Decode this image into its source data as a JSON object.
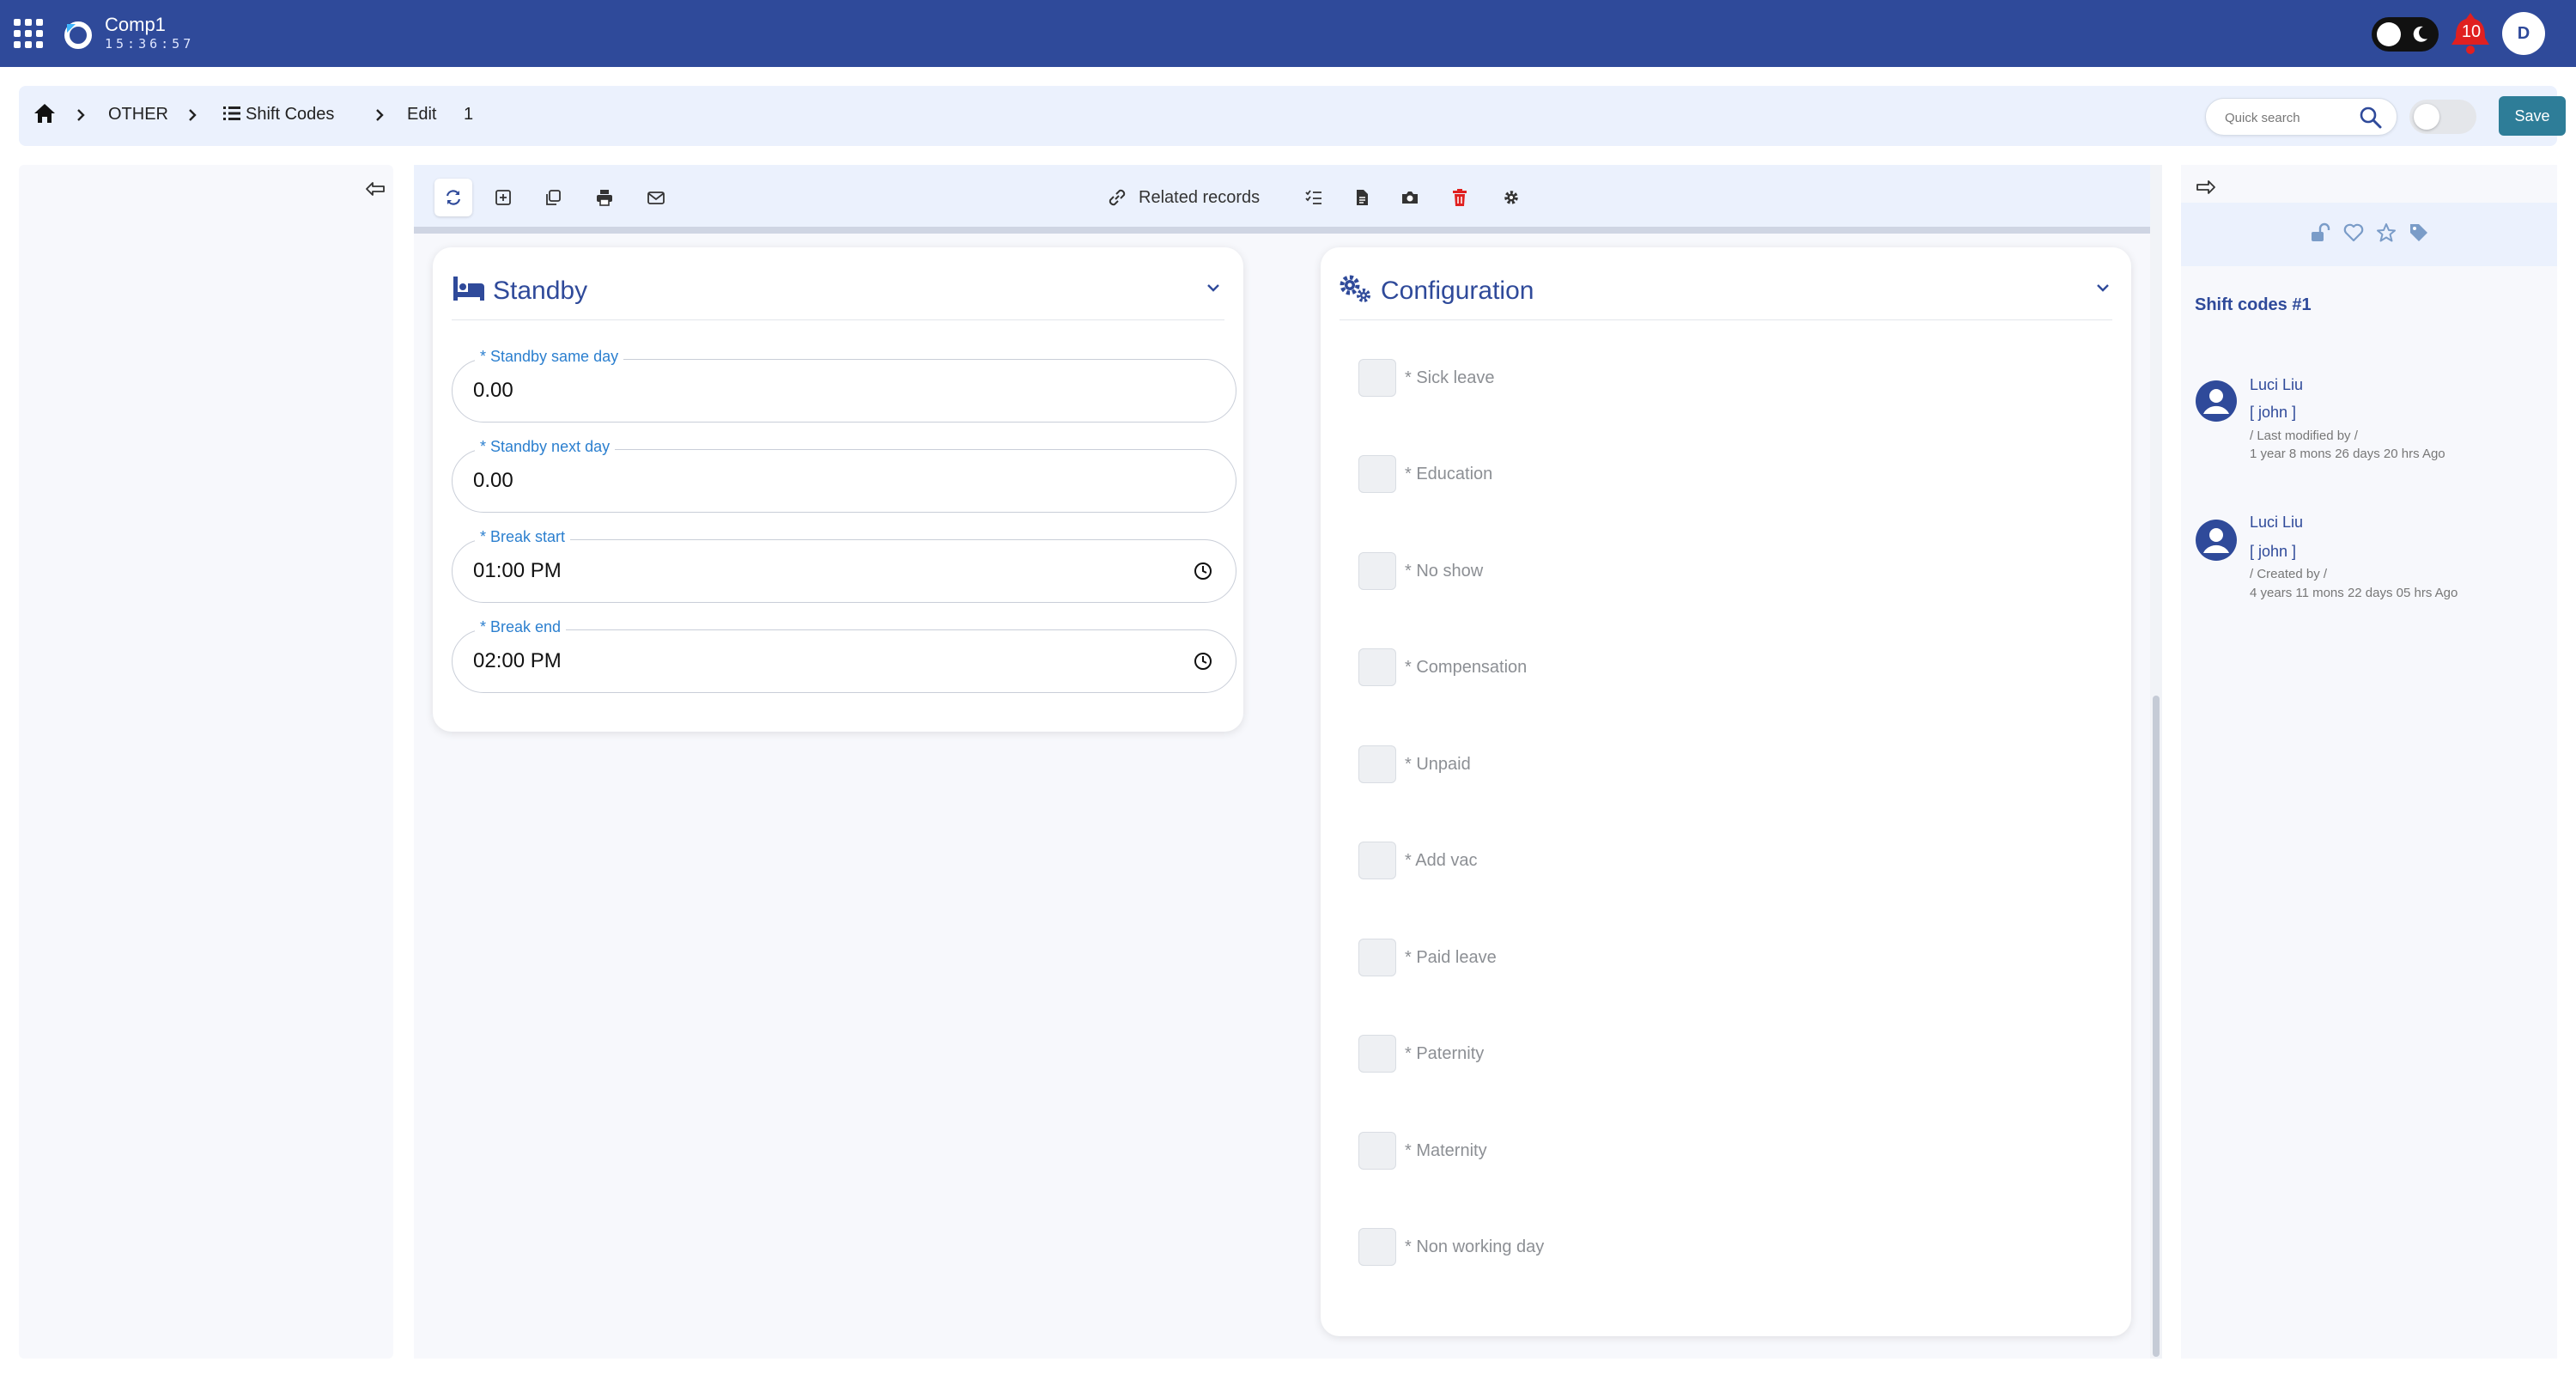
{
  "header": {
    "company": "Comp1",
    "clock": "15:36:57",
    "notifications": "10",
    "user_initial": "D"
  },
  "breadcrumb": {
    "level1": "OTHER",
    "level2": "Shift Codes",
    "level3": "Edit",
    "record_id": "1"
  },
  "search": {
    "placeholder": "Quick search"
  },
  "actions": {
    "save_label": "Save"
  },
  "toolbar": {
    "related_records": "Related records"
  },
  "standby": {
    "title": "Standby",
    "fields": [
      {
        "label": "* Standby same day",
        "value": "0.00"
      },
      {
        "label": "* Standby next day",
        "value": "0.00"
      },
      {
        "label": "* Break start",
        "value": "01:00 PM"
      },
      {
        "label": "* Break end",
        "value": "02:00 PM"
      }
    ]
  },
  "configuration": {
    "title": "Configuration",
    "items": [
      "* Sick leave",
      "* Education",
      "* No show",
      "* Compensation",
      "* Unpaid",
      "* Add vac",
      "* Paid leave",
      "* Paternity",
      "* Maternity",
      "* Non working day"
    ]
  },
  "record": {
    "title": "Shift codes #1",
    "audit": [
      {
        "name": "Luci Liu",
        "user": "[ john ]",
        "action": "/ Last modified by /",
        "when": "1 year 8 mons 26 days 20 hrs Ago"
      },
      {
        "name": "Luci Liu",
        "user": "[ john ]",
        "action": "/ Created by /",
        "when": "4 years 11 mons 22 days 05 hrs Ago"
      }
    ]
  },
  "colors": {
    "topbar": "#2f4a9a",
    "accent": "#2f4a9a",
    "save_button": "#2e7d98",
    "label_blue": "#2b7fcf",
    "notification": "#e02020",
    "delete_icon": "#e02020"
  }
}
